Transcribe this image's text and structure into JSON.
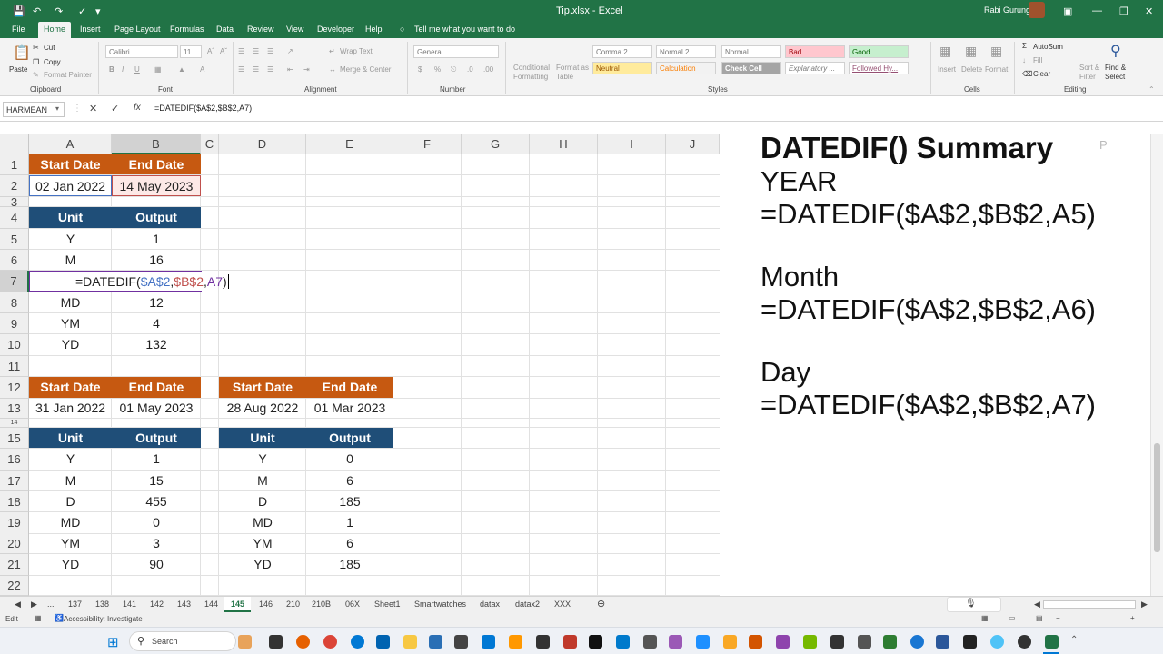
{
  "titlebar": {
    "file_title": "Tip.xlsx  -  Excel",
    "user": "Rabi Gurung"
  },
  "menu": [
    "File",
    "Home",
    "Insert",
    "Page Layout",
    "Formulas",
    "Data",
    "Review",
    "View",
    "Developer",
    "Help"
  ],
  "tell_me": "Tell me what you want to do",
  "ribbon": {
    "paste": "Paste",
    "cut": "Cut",
    "copy": "Copy",
    "format_painter": "Format Painter",
    "clipboard": "Clipboard",
    "font_name": "Calibri",
    "font_size": "11",
    "font": "Font",
    "wrap_text": "Wrap Text",
    "merge_center": "Merge & Center",
    "alignment": "Alignment",
    "number_format": "General",
    "number": "Number",
    "conditional": "Conditional Formatting",
    "format_table": "Format as Table",
    "styles_row1": [
      "Comma 2",
      "Normal 2",
      "Normal",
      "Bad",
      "Good"
    ],
    "styles_row2": [
      "Neutral",
      "Calculation",
      "Check Cell",
      "Explanatory ...",
      "Followed Hy..."
    ],
    "styles": "Styles",
    "insert": "Insert",
    "delete": "Delete",
    "format": "Format",
    "cells": "Cells",
    "autosum": "AutoSum",
    "fill": "Fill",
    "clear": "Clear",
    "sort_filter": "Sort & Filter",
    "find_select": "Find & Select",
    "editing": "Editing"
  },
  "formula_bar": {
    "name_box": "HARMEAN",
    "formula": "=DATEDIF($A$2,$B$2,A7)"
  },
  "columns": [
    "A",
    "B",
    "C",
    "D",
    "E",
    "F",
    "G",
    "H",
    "I",
    "J"
  ],
  "rows": [
    "1",
    "2",
    "3",
    "4",
    "5",
    "6",
    "7",
    "8",
    "9",
    "10",
    "11",
    "12",
    "13",
    "14",
    "15",
    "16",
    "17",
    "18",
    "19",
    "20",
    "21",
    "22"
  ],
  "table1": {
    "start_label": "Start Date",
    "end_label": "End Date",
    "start": "02 Jan 2022",
    "end": "14 May 2023",
    "unit_label": "Unit",
    "output_label": "Output",
    "rows": [
      [
        "Y",
        "1"
      ],
      [
        "M",
        "16"
      ],
      [
        "",
        ""
      ],
      [
        "MD",
        "12"
      ],
      [
        "YM",
        "4"
      ],
      [
        "YD",
        "132"
      ]
    ],
    "editing": {
      "prefix": "=DATEDIF(",
      "a": "$A$2",
      "comma1": ",",
      "b": "$B$2",
      "comma2": ",",
      "c": "A7",
      "suffix": ")"
    }
  },
  "table2": {
    "start_label": "Start Date",
    "end_label": "End Date",
    "start": "31 Jan 2022",
    "end": "01 May 2023",
    "unit_label": "Unit",
    "output_label": "Output",
    "rows": [
      [
        "Y",
        "1"
      ],
      [
        "M",
        "15"
      ],
      [
        "D",
        "455"
      ],
      [
        "MD",
        "0"
      ],
      [
        "YM",
        "3"
      ],
      [
        "YD",
        "90"
      ]
    ]
  },
  "table3": {
    "start_label": "Start Date",
    "end_label": "End Date",
    "start": "28 Aug 2022",
    "end": "01 Mar 2023",
    "unit_label": "Unit",
    "output_label": "Output",
    "rows": [
      [
        "Y",
        "0"
      ],
      [
        "M",
        "6"
      ],
      [
        "D",
        "185"
      ],
      [
        "MD",
        "1"
      ],
      [
        "YM",
        "6"
      ],
      [
        "YD",
        "185"
      ]
    ]
  },
  "summary": {
    "title": "DATEDIF() Summary",
    "year_label": "YEAR",
    "year_formula": "=DATEDIF($A$2,$B$2,A5)",
    "month_label": "Month",
    "month_formula": "=DATEDIF($A$2,$B$2,A6)",
    "day_label": "Day",
    "day_formula": "=DATEDIF($A$2,$B$2,A7)"
  },
  "sheet_tabs": [
    "...",
    "137",
    "138",
    "141",
    "142",
    "143",
    "144",
    "145",
    "146",
    "210",
    "210B",
    "06X",
    "Sheet1",
    "Smartwatches",
    "datax",
    "datax2",
    "XXX"
  ],
  "active_sheet": "145",
  "status": {
    "mode": "Edit",
    "accessibility": "Accessibility: Investigate"
  },
  "taskbar": {
    "search": "Search"
  },
  "colors": {
    "excel_green": "#217346",
    "header_orange": "#c65911",
    "header_blue": "#1f4e78"
  }
}
